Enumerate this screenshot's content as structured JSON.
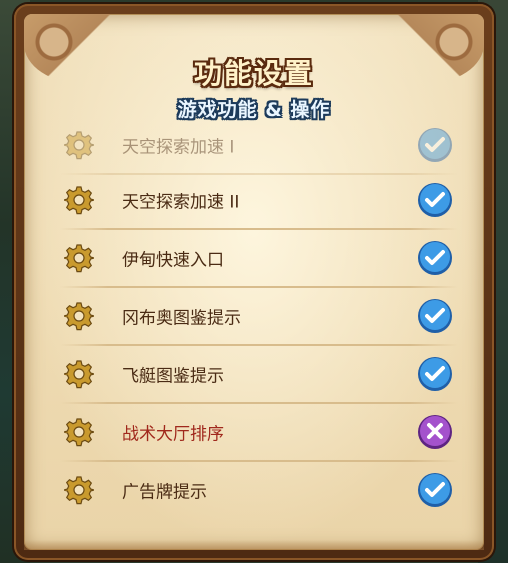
{
  "header": {
    "title": "功能设置",
    "subtitle": "游戏功能 & 操作"
  },
  "colors": {
    "enabled_badge": "#2f8ee0",
    "disabled_badge": "#8e3fb3",
    "label_text": "#4a2b14",
    "label_alert": "#a0281c"
  },
  "settings": [
    {
      "label": "天空探索加速 I",
      "state": "on",
      "icon": "gear-icon"
    },
    {
      "label": "天空探索加速 II",
      "state": "on",
      "icon": "gear-icon"
    },
    {
      "label": "伊甸快速入口",
      "state": "on",
      "icon": "gear-icon"
    },
    {
      "label": "冈布奥图鉴提示",
      "state": "on",
      "icon": "gear-icon"
    },
    {
      "label": "飞艇图鉴提示",
      "state": "on",
      "icon": "gear-icon"
    },
    {
      "label": "战术大厅排序",
      "state": "off",
      "icon": "gear-icon"
    },
    {
      "label": "广告牌提示",
      "state": "on",
      "icon": "gear-icon"
    }
  ]
}
